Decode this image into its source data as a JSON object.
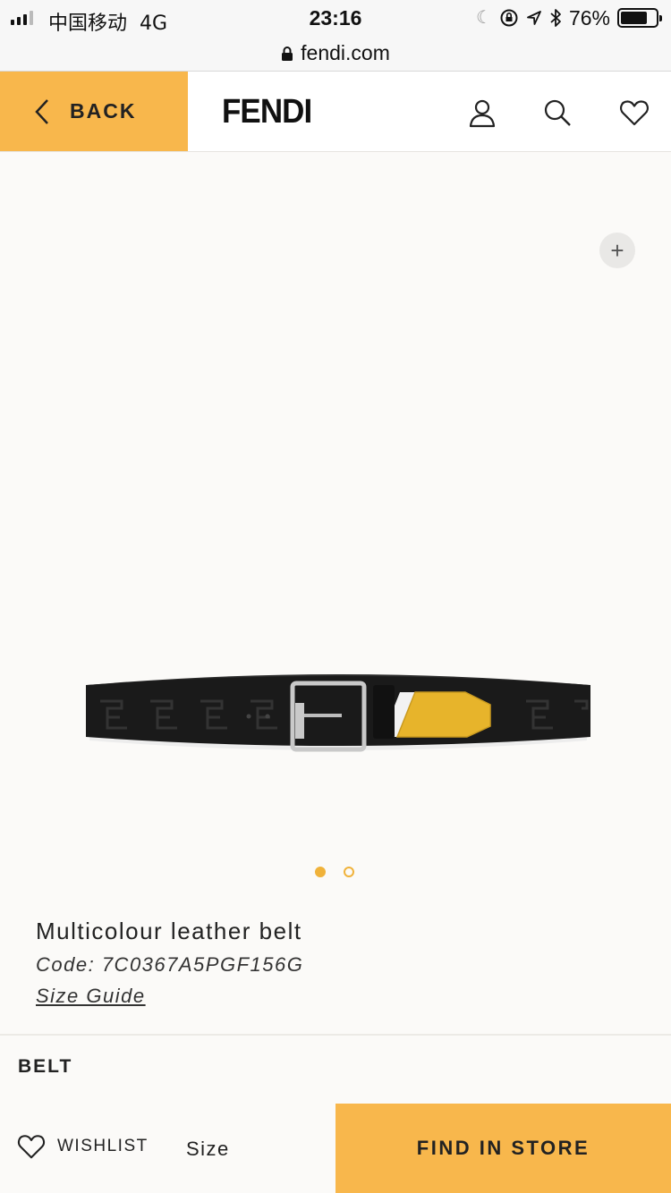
{
  "status_bar": {
    "carrier": "中国移动",
    "network": "4G",
    "time": "23:16",
    "battery_percent": "76%",
    "battery_level": 0.76,
    "icons": [
      "signal-icon",
      "moon-icon",
      "orientation-lock-icon",
      "location-icon",
      "bluetooth-icon",
      "battery-icon"
    ]
  },
  "browser": {
    "url": "fendi.com",
    "icon": "lock-icon"
  },
  "header": {
    "back_label": "BACK",
    "logo": "FENDI",
    "icons": [
      "account-icon",
      "search-icon",
      "heart-icon"
    ]
  },
  "gallery": {
    "zoom_icon": "plus-icon",
    "image_count": 2,
    "active_index": 0
  },
  "product": {
    "name": "Multicolour leather belt",
    "code": "Code: 7C0367A5PGF156G",
    "size_guide": "Size Guide",
    "category": "BELT"
  },
  "actions": {
    "wishlist_label": "WISHLIST",
    "size_label": "Size",
    "find_in_store_label": "FIND IN STORE"
  },
  "colors": {
    "accent": "#f8b74c",
    "dot": "#f0b23a",
    "background": "#fbfaf8"
  }
}
